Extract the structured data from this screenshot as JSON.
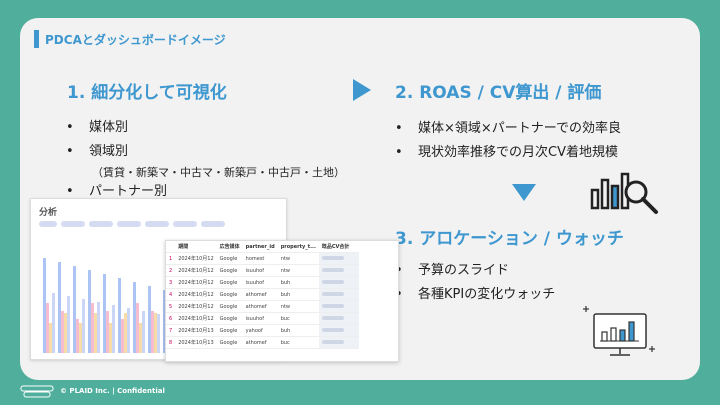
{
  "header": {
    "title": "PDCAとダッシュボードイメージ"
  },
  "section1": {
    "heading": "1. 細分化して可視化",
    "items": [
      "媒体別",
      "領域別",
      "パートナー別"
    ],
    "sub_note": "（賃貸・新築マ・中古マ・新築戸・中古戸・土地）"
  },
  "section2": {
    "heading": "2. ROAS / CV算出 / 評価",
    "items": [
      "媒体×領域×パートナーでの効率良",
      "現状効率推移での月次CV着地規模"
    ]
  },
  "section3": {
    "heading": "3. アロケーション / ウォッチ",
    "items": [
      "予算のスライド",
      "各種KPIの変化ウォッチ"
    ]
  },
  "dashboard": {
    "panel_title": "分析",
    "table_headers": [
      "",
      "期間",
      "広告媒体",
      "partner_id",
      "property_t...",
      "既品CV合計"
    ],
    "rows": [
      [
        "1",
        "2024年10月12",
        "Google",
        "homest",
        "ntw"
      ],
      [
        "2",
        "2024年10月12",
        "Google",
        "isuuhof",
        "ntw"
      ],
      [
        "3",
        "2024年10月12",
        "Google",
        "isuuhof",
        "buh"
      ],
      [
        "4",
        "2024年10月12",
        "Google",
        "athomef",
        "buh"
      ],
      [
        "5",
        "2024年10月12",
        "Google",
        "athomef",
        "ntw"
      ],
      [
        "6",
        "2024年10月12",
        "Google",
        "isuuhof",
        "buc"
      ],
      [
        "7",
        "2024年10月13",
        "Google",
        "yahoof",
        "buh"
      ],
      [
        "8",
        "2024年10月13",
        "Google",
        "athomef",
        "buc"
      ]
    ]
  },
  "footer": {
    "text": "© PLAID Inc.  |  Confidential"
  },
  "colors": {
    "accent": "#3e97cf",
    "background": "#4fae9c"
  },
  "icons": [
    "arrow-right-icon",
    "arrow-down-icon",
    "bar-chart-magnifier-icon",
    "monitor-chart-icon"
  ]
}
